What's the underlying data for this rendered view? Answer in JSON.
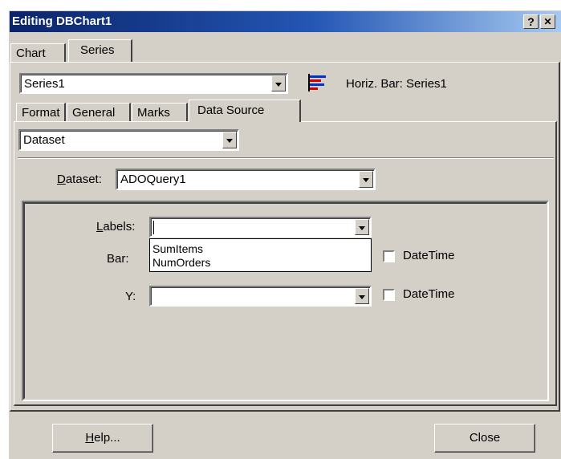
{
  "window": {
    "title": "Editing DBChart1",
    "help_glyph": "?",
    "close_glyph": "✕"
  },
  "top_tabs": [
    {
      "label": "Chart",
      "active": false
    },
    {
      "label": "Series",
      "active": true
    }
  ],
  "series_selector": {
    "value": "Series1",
    "icon": "horizontal-bar-chart-icon",
    "description": "Horiz. Bar: Series1"
  },
  "series_tabs": [
    {
      "label": "Format",
      "active": false
    },
    {
      "label": "General",
      "active": false
    },
    {
      "label": "Marks",
      "active": false
    },
    {
      "label": "Data Source",
      "active": true
    }
  ],
  "data_source": {
    "source_type": "Dataset",
    "dataset_label_accel": "D",
    "dataset_label_rest": "ataset:",
    "dataset_value": "ADOQuery1",
    "labels_label_accel": "L",
    "labels_label_rest": "abels:",
    "labels_value": "",
    "labels_options": [
      "SumItems",
      "NumOrders"
    ],
    "bar_label": "Bar:",
    "bar_datetime_label": "DateTime",
    "y_label": "Y:",
    "y_value": "",
    "y_datetime_label": "DateTime"
  },
  "buttons": {
    "help_accel": "H",
    "help_rest": "elp...",
    "close": "Close"
  }
}
